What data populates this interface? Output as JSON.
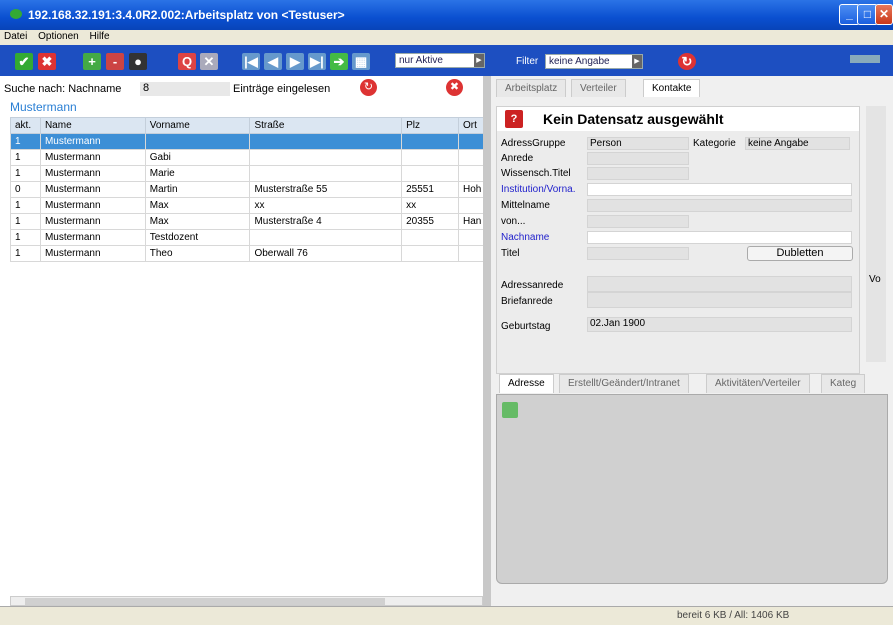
{
  "window": {
    "title": "192.168.32.191:3.4.0R2.002:Arbeitsplatz von <Testuser>"
  },
  "menu": [
    "Datei",
    "Optionen",
    "Hilfe"
  ],
  "toolbar": {
    "filter_active": "nur Aktive",
    "filter_label": "Filter",
    "filter_value": "keine Angabe"
  },
  "search": {
    "label": "Suche nach: Nachname",
    "count": "8",
    "load_label": "Einträge eingelesen",
    "term": "Mustermann"
  },
  "table": {
    "headers": [
      "akt.",
      "Name",
      "Vorname",
      "Straße",
      "Plz",
      "Ort"
    ],
    "rows": [
      [
        "1",
        "Mustermann",
        "",
        "",
        "",
        ""
      ],
      [
        "1",
        "Mustermann",
        "Gabi",
        "",
        "",
        ""
      ],
      [
        "1",
        "Mustermann",
        "Marie",
        "",
        "",
        ""
      ],
      [
        "0",
        "Mustermann",
        "Martin",
        "Musterstraße 55",
        "25551",
        "Hoh"
      ],
      [
        "1",
        "Mustermann",
        "Max",
        "xx",
        "xx",
        ""
      ],
      [
        "1",
        "Mustermann",
        "Max",
        "Musterstraße 4",
        "20355",
        "Han"
      ],
      [
        "1",
        "Mustermann",
        "Testdozent",
        "",
        "",
        ""
      ],
      [
        "1",
        "Mustermann",
        "Theo",
        "Oberwall 76",
        "",
        ""
      ]
    ]
  },
  "tabs": [
    "Arbeitsplatz",
    "Verteiler",
    "Kontakte"
  ],
  "form": {
    "title": "Kein Datensatz ausgewählt",
    "adressgruppe_label": "AdressGruppe",
    "adressgruppe_value": "Person",
    "kategorie_label": "Kategorie",
    "kategorie_value": "keine Angabe",
    "anrede": "Anrede",
    "wiss_titel": "Wissensch.Titel",
    "institution": "Institution/Vorna.",
    "mittelname": "Mittelname",
    "von": "von...",
    "nachname": "Nachname",
    "titel": "Titel",
    "dubletten": "Dubletten",
    "adressanrede": "Adressanrede",
    "briefanrede": "Briefanrede",
    "geburtstag_label": "Geburtstag",
    "geburtstag_value": "02.Jan 1900"
  },
  "side_label": "Vo",
  "subtabs": [
    "Adresse",
    "Erstellt/Geändert/Intranet",
    "Aktivitäten/Verteiler",
    "Kateg"
  ],
  "status": {
    "memory": "bereit 6 KB / All: 1406 KB"
  },
  "colors": {
    "titlebar": "#0a4fd0",
    "toolbar": "#1d4fc1",
    "selected_row": "#3d8fd6",
    "link_label": "#2222cc"
  }
}
